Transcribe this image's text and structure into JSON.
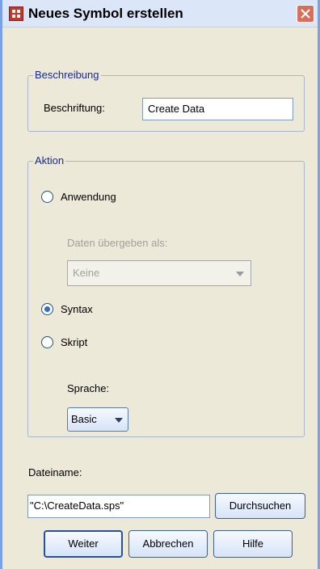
{
  "window": {
    "title": "Neues Symbol erstellen"
  },
  "description_group": {
    "legend": "Beschreibung",
    "label": "Beschriftung:",
    "value": "Create Data"
  },
  "action_group": {
    "legend": "Aktion",
    "options": [
      {
        "label": "Anwendung",
        "checked": false
      },
      {
        "label": "Syntax",
        "checked": true
      },
      {
        "label": "Skript",
        "checked": false
      }
    ],
    "pass_data_label": "Daten übergeben als:",
    "pass_data_value": "Keine",
    "language_label": "Sprache:",
    "language_value": "Basic"
  },
  "file": {
    "label": "Dateiname:",
    "value": "\"C:\\CreateData.sps\"",
    "browse_label": "Durchsuchen"
  },
  "buttons": {
    "continue": "Weiter",
    "cancel": "Abbrechen",
    "help": "Hilfe"
  }
}
